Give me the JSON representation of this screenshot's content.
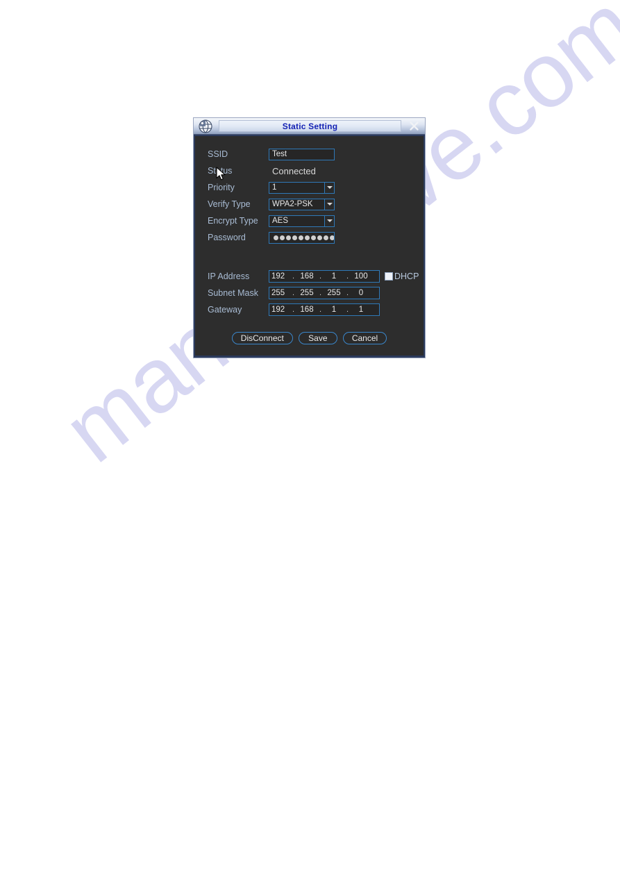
{
  "watermark": {
    "text": "manualshive.com",
    "color": "#d7d7f2"
  },
  "dialog": {
    "title": "Static Setting",
    "logo_icon": "globe-logo-icon",
    "close_icon": "close-icon",
    "fields": {
      "ssid": {
        "label": "SSID",
        "value": "Test"
      },
      "status": {
        "label": "Status",
        "value": "Connected"
      },
      "priority": {
        "label": "Priority",
        "value": "1"
      },
      "verify_type": {
        "label": "Verify Type",
        "value": "WPA2-PSK"
      },
      "encrypt_type": {
        "label": "Encrypt Type",
        "value": "AES"
      },
      "password": {
        "label": "Password",
        "dots": 11
      },
      "ip_address": {
        "label": "IP Address",
        "segments": [
          "192",
          "168",
          "1",
          "100"
        ]
      },
      "subnet_mask": {
        "label": "Subnet Mask",
        "segments": [
          "255",
          "255",
          "255",
          "0"
        ]
      },
      "gateway": {
        "label": "Gateway",
        "segments": [
          "192",
          "168",
          "1",
          "1"
        ]
      }
    },
    "dhcp": {
      "label": "DHCP",
      "checked": false
    },
    "separator": ".",
    "buttons": {
      "disconnect": "DisConnect",
      "save": "Save",
      "cancel": "Cancel"
    },
    "colors": {
      "field_border": "#2f79b8",
      "label_text": "#a9bcd4",
      "title_text": "#1422b4",
      "body_bg": "#2d2d2d"
    }
  }
}
